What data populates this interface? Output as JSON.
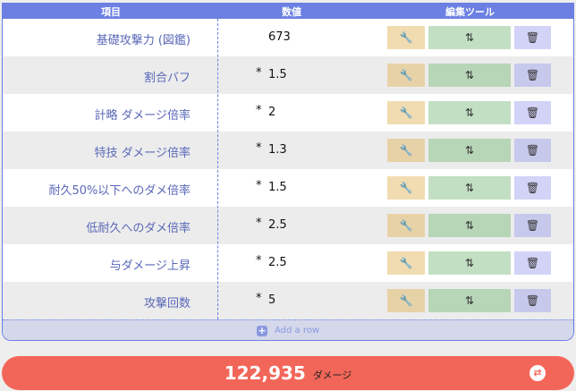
{
  "header": {
    "item": "項目",
    "value": "数値",
    "tools": "編集ツール"
  },
  "rows": [
    {
      "label": "基礎攻撃力 (図鑑)",
      "op": "",
      "value": "673"
    },
    {
      "label": "割合バフ",
      "op": "*",
      "value": "1.5"
    },
    {
      "label": "計略 ダメージ倍率",
      "op": "*",
      "value": "2"
    },
    {
      "label": "特技 ダメージ倍率",
      "op": "*",
      "value": "1.3"
    },
    {
      "label": "耐久50%以下へのダメ倍率",
      "op": "*",
      "value": "1.5"
    },
    {
      "label": "低耐久へのダメ倍率",
      "op": "*",
      "value": "2.5"
    },
    {
      "label": "与ダメージ上昇",
      "op": "*",
      "value": "2.5"
    },
    {
      "label": "攻撃回数",
      "op": "*",
      "value": "5"
    }
  ],
  "icons": {
    "edit": "wrench-icon",
    "move": "sort-arrows-icon",
    "delete": "trash-icon",
    "add": "plus-icon",
    "swap": "swap-icon"
  },
  "add_row": "Add a row",
  "total": {
    "value": "122,935",
    "unit": "ダメージ"
  },
  "colors": {
    "header": "#6b80e2",
    "total": "#f26659"
  }
}
